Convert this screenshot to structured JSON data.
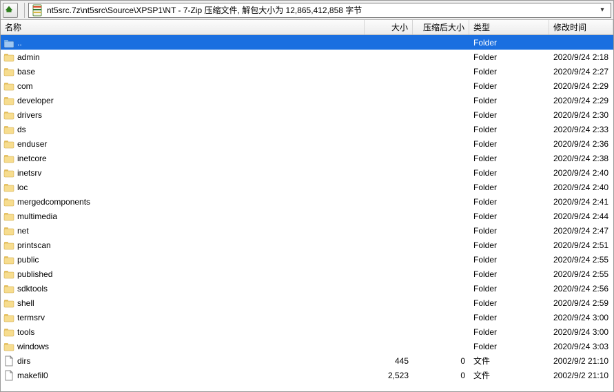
{
  "toolbar": {
    "path": "nt5src.7z\\nt5src\\Source\\XPSP1\\NT - 7-Zip 压缩文件, 解包大小为 12,865,412,858 字节"
  },
  "columns": {
    "name": "名称",
    "size": "大小",
    "packed": "压缩后大小",
    "type": "类型",
    "modified": "修改时间"
  },
  "parent_row": {
    "name": "..",
    "type": "Folder"
  },
  "rows": [
    {
      "kind": "folder",
      "name": "admin",
      "type": "Folder",
      "modified": "2020/9/24 2:18"
    },
    {
      "kind": "folder",
      "name": "base",
      "type": "Folder",
      "modified": "2020/9/24 2:27"
    },
    {
      "kind": "folder",
      "name": "com",
      "type": "Folder",
      "modified": "2020/9/24 2:29"
    },
    {
      "kind": "folder",
      "name": "developer",
      "type": "Folder",
      "modified": "2020/9/24 2:29"
    },
    {
      "kind": "folder",
      "name": "drivers",
      "type": "Folder",
      "modified": "2020/9/24 2:30"
    },
    {
      "kind": "folder",
      "name": "ds",
      "type": "Folder",
      "modified": "2020/9/24 2:33"
    },
    {
      "kind": "folder",
      "name": "enduser",
      "type": "Folder",
      "modified": "2020/9/24 2:36"
    },
    {
      "kind": "folder",
      "name": "inetcore",
      "type": "Folder",
      "modified": "2020/9/24 2:38"
    },
    {
      "kind": "folder",
      "name": "inetsrv",
      "type": "Folder",
      "modified": "2020/9/24 2:40"
    },
    {
      "kind": "folder",
      "name": "loc",
      "type": "Folder",
      "modified": "2020/9/24 2:40"
    },
    {
      "kind": "folder",
      "name": "mergedcomponents",
      "type": "Folder",
      "modified": "2020/9/24 2:41"
    },
    {
      "kind": "folder",
      "name": "multimedia",
      "type": "Folder",
      "modified": "2020/9/24 2:44"
    },
    {
      "kind": "folder",
      "name": "net",
      "type": "Folder",
      "modified": "2020/9/24 2:47"
    },
    {
      "kind": "folder",
      "name": "printscan",
      "type": "Folder",
      "modified": "2020/9/24 2:51"
    },
    {
      "kind": "folder",
      "name": "public",
      "type": "Folder",
      "modified": "2020/9/24 2:55"
    },
    {
      "kind": "folder",
      "name": "published",
      "type": "Folder",
      "modified": "2020/9/24 2:55"
    },
    {
      "kind": "folder",
      "name": "sdktools",
      "type": "Folder",
      "modified": "2020/9/24 2:56"
    },
    {
      "kind": "folder",
      "name": "shell",
      "type": "Folder",
      "modified": "2020/9/24 2:59"
    },
    {
      "kind": "folder",
      "name": "termsrv",
      "type": "Folder",
      "modified": "2020/9/24 3:00"
    },
    {
      "kind": "folder",
      "name": "tools",
      "type": "Folder",
      "modified": "2020/9/24 3:00"
    },
    {
      "kind": "folder",
      "name": "windows",
      "type": "Folder",
      "modified": "2020/9/24 3:03"
    },
    {
      "kind": "file",
      "name": "dirs",
      "size": "445",
      "packed": "0",
      "type": "文件",
      "modified": "2002/9/2 21:10"
    },
    {
      "kind": "file",
      "name": "makefil0",
      "size": "2,523",
      "packed": "0",
      "type": "文件",
      "modified": "2002/9/2 21:10"
    }
  ]
}
